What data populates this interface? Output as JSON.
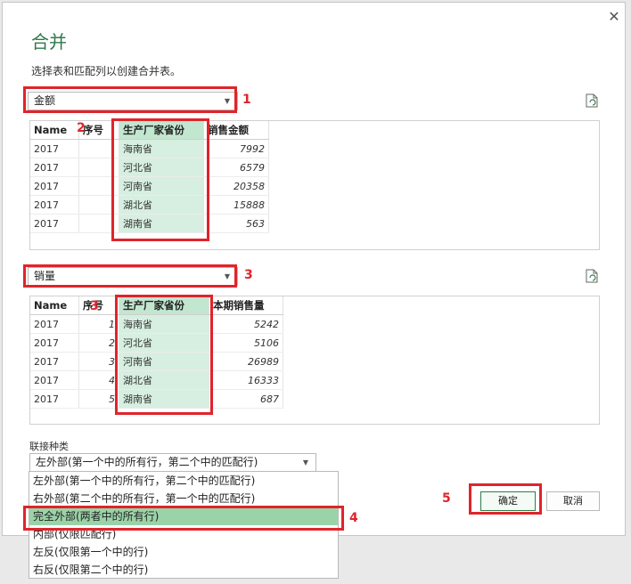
{
  "dialog": {
    "title": "合并",
    "subtitle": "选择表和匹配列以创建合并表。",
    "close_glyph": "✕"
  },
  "table1": {
    "selected": "金额",
    "headers": [
      "Name",
      "序号",
      "生产厂家省份",
      "销售金额"
    ],
    "rows": [
      [
        "2017",
        "",
        "海南省",
        "7992"
      ],
      [
        "2017",
        "",
        "河北省",
        "6579"
      ],
      [
        "2017",
        "",
        "河南省",
        "20358"
      ],
      [
        "2017",
        "",
        "湖北省",
        "15888"
      ],
      [
        "2017",
        "",
        "湖南省",
        "563"
      ]
    ]
  },
  "table2": {
    "selected": "销量",
    "headers": [
      "Name",
      "序号",
      "生产厂家省份",
      "本期销售量"
    ],
    "rows": [
      [
        "2017",
        "1",
        "海南省",
        "5242"
      ],
      [
        "2017",
        "2",
        "河北省",
        "5106"
      ],
      [
        "2017",
        "3",
        "河南省",
        "26989"
      ],
      [
        "2017",
        "4",
        "湖北省",
        "16333"
      ],
      [
        "2017",
        "5",
        "湖南省",
        "687"
      ]
    ]
  },
  "join": {
    "label": "联接种类",
    "selected": "左外部(第一个中的所有行，第二个中的匹配行)",
    "options": [
      "左外部(第一个中的所有行，第二个中的匹配行)",
      "右外部(第二个中的所有行，第一个中的匹配行)",
      "完全外部(两者中的所有行)",
      "内部(仅限匹配行)",
      "左反(仅限第一个中的行)",
      "右反(仅限第二个中的行)"
    ],
    "active_index": 2
  },
  "buttons": {
    "ok": "确定",
    "cancel": "取消"
  },
  "annotations": {
    "m1": "1",
    "m2": "2",
    "m3": "3",
    "m3b": "3",
    "m4": "4",
    "m5": "5"
  },
  "colors": {
    "accent": "#2f7a4a",
    "highlight": "#e0242a",
    "selected_column": "#d7efe0",
    "active_option": "#9bd3a8"
  }
}
